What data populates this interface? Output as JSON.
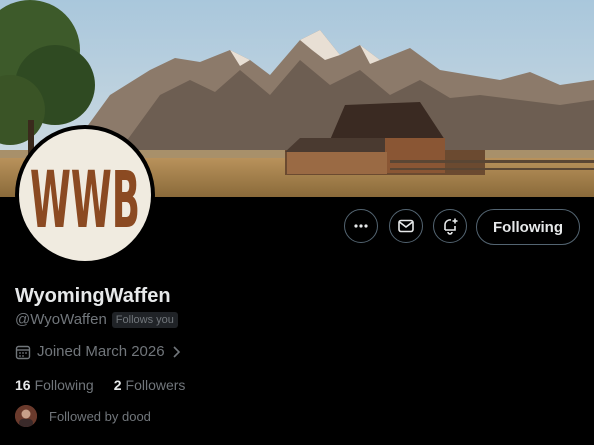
{
  "profile": {
    "display_name": "WyomingWaffen",
    "handle": "@WyoWaffen",
    "follows_you_badge": "Follows you",
    "joined": "Joined March 2026",
    "avatar_monogram": "WWB",
    "banner_description_icon": "barn-mountain-banner"
  },
  "actions": {
    "more_icon": "more-icon",
    "message_icon": "mail-icon",
    "notify_icon": "bell-plus-icon",
    "following_label": "Following"
  },
  "stats": {
    "following_count": "16",
    "following_label": "Following",
    "followers_count": "2",
    "followers_label": "Followers"
  },
  "followed_by": {
    "text": "Followed by dood"
  },
  "colors": {
    "background": "#000000",
    "primary_text": "#e7e9ea",
    "secondary_text": "#71767b",
    "border": "#536471",
    "monogram_brown": "#8b4a22",
    "avatar_bg": "#f0ebe0"
  }
}
